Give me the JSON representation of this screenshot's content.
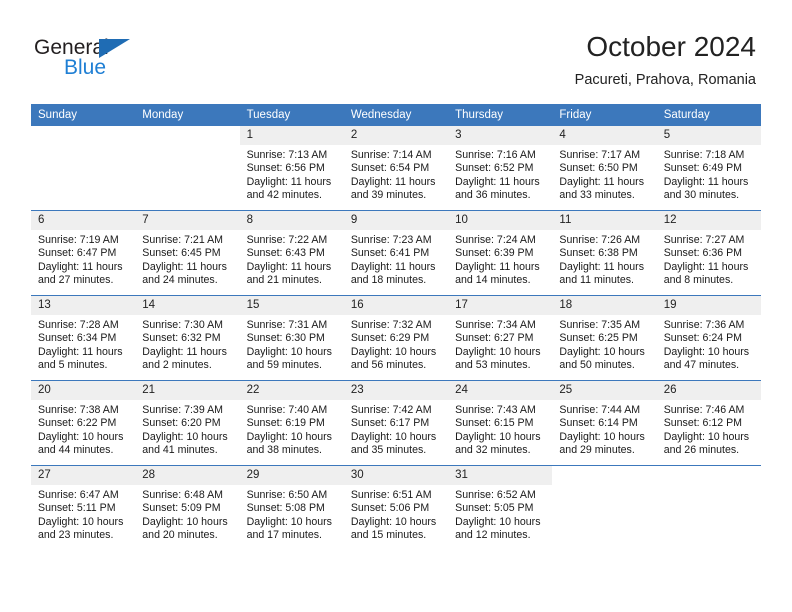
{
  "brand": {
    "name_top": "General",
    "name_bottom": "Blue",
    "color_dark": "#231f20",
    "color_blue": "#1f7fd4",
    "triangle_color": "#1f6cb4"
  },
  "header": {
    "month_title": "October 2024",
    "location": "Pacureti, Prahova, Romania"
  },
  "theme": {
    "header_bg": "#3c78bc",
    "header_text": "#ffffff",
    "daynum_bg": "#efefef",
    "grid_line": "#3c78bc",
    "body_text": "#1a1a1a"
  },
  "weekday_headers": [
    "Sunday",
    "Monday",
    "Tuesday",
    "Wednesday",
    "Thursday",
    "Friday",
    "Saturday"
  ],
  "labels": {
    "sunrise_prefix": "Sunrise: ",
    "sunset_prefix": "Sunset: ",
    "daylight_prefix": "Daylight: "
  },
  "weeks": [
    [
      {
        "day": "",
        "blank": true
      },
      {
        "day": "",
        "blank": true
      },
      {
        "day": "1",
        "sunrise": "Sunrise: 7:13 AM",
        "sunset": "Sunset: 6:56 PM",
        "daylight": "Daylight: 11 hours and 42 minutes."
      },
      {
        "day": "2",
        "sunrise": "Sunrise: 7:14 AM",
        "sunset": "Sunset: 6:54 PM",
        "daylight": "Daylight: 11 hours and 39 minutes."
      },
      {
        "day": "3",
        "sunrise": "Sunrise: 7:16 AM",
        "sunset": "Sunset: 6:52 PM",
        "daylight": "Daylight: 11 hours and 36 minutes."
      },
      {
        "day": "4",
        "sunrise": "Sunrise: 7:17 AM",
        "sunset": "Sunset: 6:50 PM",
        "daylight": "Daylight: 11 hours and 33 minutes."
      },
      {
        "day": "5",
        "sunrise": "Sunrise: 7:18 AM",
        "sunset": "Sunset: 6:49 PM",
        "daylight": "Daylight: 11 hours and 30 minutes."
      }
    ],
    [
      {
        "day": "6",
        "sunrise": "Sunrise: 7:19 AM",
        "sunset": "Sunset: 6:47 PM",
        "daylight": "Daylight: 11 hours and 27 minutes."
      },
      {
        "day": "7",
        "sunrise": "Sunrise: 7:21 AM",
        "sunset": "Sunset: 6:45 PM",
        "daylight": "Daylight: 11 hours and 24 minutes."
      },
      {
        "day": "8",
        "sunrise": "Sunrise: 7:22 AM",
        "sunset": "Sunset: 6:43 PM",
        "daylight": "Daylight: 11 hours and 21 minutes."
      },
      {
        "day": "9",
        "sunrise": "Sunrise: 7:23 AM",
        "sunset": "Sunset: 6:41 PM",
        "daylight": "Daylight: 11 hours and 18 minutes."
      },
      {
        "day": "10",
        "sunrise": "Sunrise: 7:24 AM",
        "sunset": "Sunset: 6:39 PM",
        "daylight": "Daylight: 11 hours and 14 minutes."
      },
      {
        "day": "11",
        "sunrise": "Sunrise: 7:26 AM",
        "sunset": "Sunset: 6:38 PM",
        "daylight": "Daylight: 11 hours and 11 minutes."
      },
      {
        "day": "12",
        "sunrise": "Sunrise: 7:27 AM",
        "sunset": "Sunset: 6:36 PM",
        "daylight": "Daylight: 11 hours and 8 minutes."
      }
    ],
    [
      {
        "day": "13",
        "sunrise": "Sunrise: 7:28 AM",
        "sunset": "Sunset: 6:34 PM",
        "daylight": "Daylight: 11 hours and 5 minutes."
      },
      {
        "day": "14",
        "sunrise": "Sunrise: 7:30 AM",
        "sunset": "Sunset: 6:32 PM",
        "daylight": "Daylight: 11 hours and 2 minutes."
      },
      {
        "day": "15",
        "sunrise": "Sunrise: 7:31 AM",
        "sunset": "Sunset: 6:30 PM",
        "daylight": "Daylight: 10 hours and 59 minutes."
      },
      {
        "day": "16",
        "sunrise": "Sunrise: 7:32 AM",
        "sunset": "Sunset: 6:29 PM",
        "daylight": "Daylight: 10 hours and 56 minutes."
      },
      {
        "day": "17",
        "sunrise": "Sunrise: 7:34 AM",
        "sunset": "Sunset: 6:27 PM",
        "daylight": "Daylight: 10 hours and 53 minutes."
      },
      {
        "day": "18",
        "sunrise": "Sunrise: 7:35 AM",
        "sunset": "Sunset: 6:25 PM",
        "daylight": "Daylight: 10 hours and 50 minutes."
      },
      {
        "day": "19",
        "sunrise": "Sunrise: 7:36 AM",
        "sunset": "Sunset: 6:24 PM",
        "daylight": "Daylight: 10 hours and 47 minutes."
      }
    ],
    [
      {
        "day": "20",
        "sunrise": "Sunrise: 7:38 AM",
        "sunset": "Sunset: 6:22 PM",
        "daylight": "Daylight: 10 hours and 44 minutes."
      },
      {
        "day": "21",
        "sunrise": "Sunrise: 7:39 AM",
        "sunset": "Sunset: 6:20 PM",
        "daylight": "Daylight: 10 hours and 41 minutes."
      },
      {
        "day": "22",
        "sunrise": "Sunrise: 7:40 AM",
        "sunset": "Sunset: 6:19 PM",
        "daylight": "Daylight: 10 hours and 38 minutes."
      },
      {
        "day": "23",
        "sunrise": "Sunrise: 7:42 AM",
        "sunset": "Sunset: 6:17 PM",
        "daylight": "Daylight: 10 hours and 35 minutes."
      },
      {
        "day": "24",
        "sunrise": "Sunrise: 7:43 AM",
        "sunset": "Sunset: 6:15 PM",
        "daylight": "Daylight: 10 hours and 32 minutes."
      },
      {
        "day": "25",
        "sunrise": "Sunrise: 7:44 AM",
        "sunset": "Sunset: 6:14 PM",
        "daylight": "Daylight: 10 hours and 29 minutes."
      },
      {
        "day": "26",
        "sunrise": "Sunrise: 7:46 AM",
        "sunset": "Sunset: 6:12 PM",
        "daylight": "Daylight: 10 hours and 26 minutes."
      }
    ],
    [
      {
        "day": "27",
        "sunrise": "Sunrise: 6:47 AM",
        "sunset": "Sunset: 5:11 PM",
        "daylight": "Daylight: 10 hours and 23 minutes."
      },
      {
        "day": "28",
        "sunrise": "Sunrise: 6:48 AM",
        "sunset": "Sunset: 5:09 PM",
        "daylight": "Daylight: 10 hours and 20 minutes."
      },
      {
        "day": "29",
        "sunrise": "Sunrise: 6:50 AM",
        "sunset": "Sunset: 5:08 PM",
        "daylight": "Daylight: 10 hours and 17 minutes."
      },
      {
        "day": "30",
        "sunrise": "Sunrise: 6:51 AM",
        "sunset": "Sunset: 5:06 PM",
        "daylight": "Daylight: 10 hours and 15 minutes."
      },
      {
        "day": "31",
        "sunrise": "Sunrise: 6:52 AM",
        "sunset": "Sunset: 5:05 PM",
        "daylight": "Daylight: 10 hours and 12 minutes."
      },
      {
        "day": "",
        "blank": true
      },
      {
        "day": "",
        "blank": true
      }
    ]
  ]
}
